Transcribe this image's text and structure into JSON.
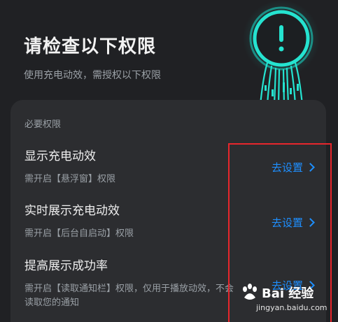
{
  "header": {
    "title": "请检查以下权限",
    "subtitle": "使用充电动效，需授权以下权限"
  },
  "graphic": {
    "icon": "exclamation-icon",
    "accent": "#25e3d0"
  },
  "section": {
    "label": "必要权限"
  },
  "permissions": [
    {
      "title": "显示充电动效",
      "desc": "需开启【悬浮窗】权限",
      "action": "去设置"
    },
    {
      "title": "实时展示充电动效",
      "desc": "需开启【后台自启动】权限",
      "action": "去设置"
    },
    {
      "title": "提高展示成功率",
      "desc": "需开启【读取通知栏】权限，仅用于播放动效，不会读取您的通知",
      "action": "去设置"
    }
  ],
  "watermark": {
    "brand": "Bai 经验",
    "domain": "jingyan.baidu.com"
  },
  "colors": {
    "background": "#202124",
    "card": "#2c2d30",
    "link": "#1e8fff",
    "highlight": "#e8262c"
  }
}
